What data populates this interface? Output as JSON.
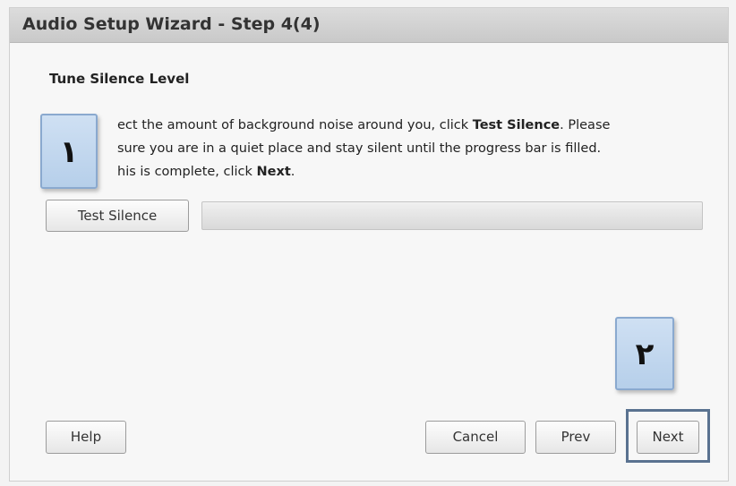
{
  "window": {
    "title": "Audio Setup Wizard - Step 4(4)"
  },
  "section": {
    "title": "Tune Silence Level"
  },
  "instructions": {
    "line1_a": "ect the amount of background noise around you, click ",
    "line1_b": "Test Silence",
    "line1_c": ". Please",
    "line2": "sure you are in a quiet place and stay silent until the progress bar is filled.",
    "line3_a": "his is complete, click ",
    "line3_b": "Next",
    "line3_c": "."
  },
  "controls": {
    "test_silence_label": "Test Silence",
    "progress_value_percent": 0
  },
  "footer": {
    "help_label": "Help",
    "cancel_label": "Cancel",
    "prev_label": "Prev",
    "next_label": "Next"
  },
  "annotations": {
    "badge_1": "١",
    "badge_2": "٢"
  }
}
